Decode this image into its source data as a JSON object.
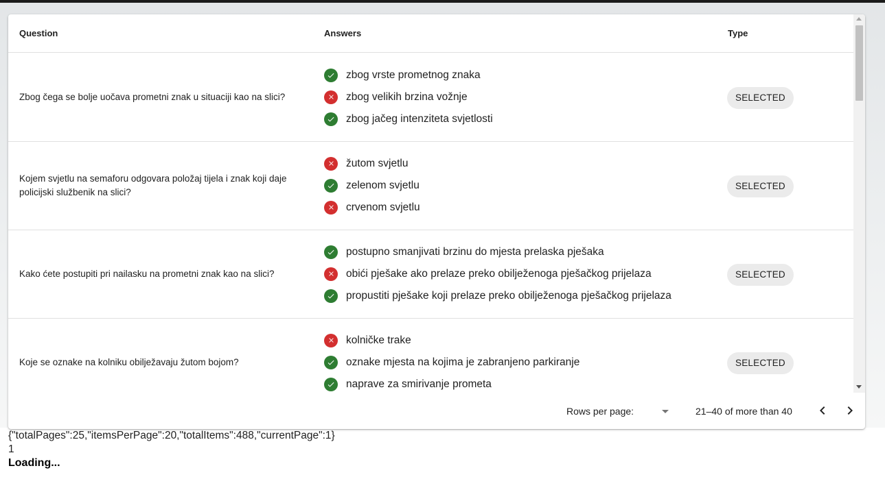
{
  "table": {
    "headers": {
      "question": "Question",
      "answers": "Answers",
      "type": "Type"
    },
    "rows": [
      {
        "question": "Zbog čega se bolje uočava prometni znak u situaciji kao na slici?",
        "answers": [
          {
            "text": "zbog vrste prometnog znaka",
            "correct": true
          },
          {
            "text": "zbog velikih brzina vožnje",
            "correct": false
          },
          {
            "text": "zbog jačeg intenziteta svjetlosti",
            "correct": true
          }
        ],
        "type": "SELECTED"
      },
      {
        "question": "Kojem svjetlu na semaforu odgovara položaj tijela i znak koji daje policijski službenik na slici?",
        "answers": [
          {
            "text": "žutom svjetlu",
            "correct": false
          },
          {
            "text": "zelenom svjetlu",
            "correct": true
          },
          {
            "text": "crvenom svjetlu",
            "correct": false
          }
        ],
        "type": "SELECTED"
      },
      {
        "question": "Kako ćete postupiti pri nailasku na prometni znak kao na slici?",
        "answers": [
          {
            "text": "postupno smanjivati brzinu do mjesta prelaska pješaka",
            "correct": true
          },
          {
            "text": "obići pješake ako prelaze preko obilježenoga pješačkog prijelaza",
            "correct": false
          },
          {
            "text": "propustiti pješake koji prelaze preko obilježenoga pješačkog prijelaza",
            "correct": true
          }
        ],
        "type": "SELECTED"
      },
      {
        "question": "Koje se oznake na kolniku obilježavaju žutom bojom?",
        "answers": [
          {
            "text": "kolničke trake",
            "correct": false
          },
          {
            "text": "oznake mjesta na kojima je zabranjeno parkiranje",
            "correct": true
          },
          {
            "text": "naprave za smirivanje prometa",
            "correct": true
          }
        ],
        "type": "SELECTED"
      }
    ]
  },
  "pagination": {
    "rows_per_page_label": "Rows per page:",
    "rows_per_page_value": "",
    "displayed_rows": "21–40 of more than 40",
    "prev_icon": "chevron-left-icon",
    "next_icon": "chevron-right-icon"
  },
  "debug": {
    "json_line": "{\"totalPages\":25,\"itemsPerPage\":20,\"totalItems\":488,\"currentPage\":1}",
    "page_number": "1",
    "loading": "Loading..."
  },
  "colors": {
    "correct": "#2e7d32",
    "incorrect": "#d32f2f",
    "chip_bg": "#ebebeb"
  }
}
